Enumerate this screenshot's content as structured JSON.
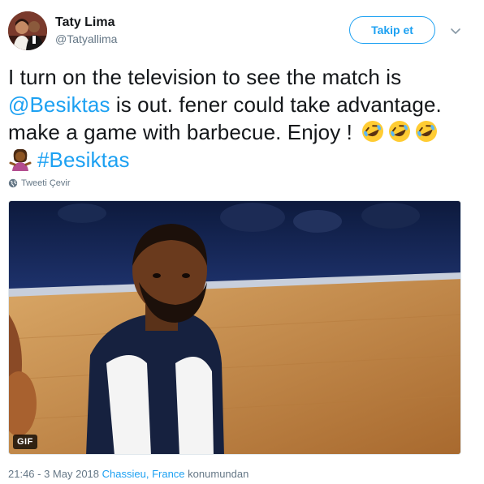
{
  "user": {
    "display_name": "Taty Lima",
    "handle": "@Tatyallima"
  },
  "follow_button": {
    "label": "Takip et"
  },
  "tweet": {
    "line1": "I turn on the television to see the match is",
    "mention": "@Besiktas",
    "line2_rest": " is out. fener could take advantage.",
    "line3": "make a game with barbecue. Enjoy !",
    "hashtag": "#Besiktas",
    "emoji": [
      "rolling-on-floor-laughing",
      "rolling-on-floor-laughing",
      "rolling-on-floor-laughing",
      "woman-shrugging"
    ]
  },
  "translate_label": "Tweeti Çevir",
  "media": {
    "badge": "GIF"
  },
  "meta": {
    "time": "21:46 - 3 May 2018",
    "location": "Chassieu, France",
    "suffix": "konumundan"
  },
  "colors": {
    "accent": "#1da1f2",
    "secondary_text": "#657786",
    "primary_text": "#14171a"
  }
}
